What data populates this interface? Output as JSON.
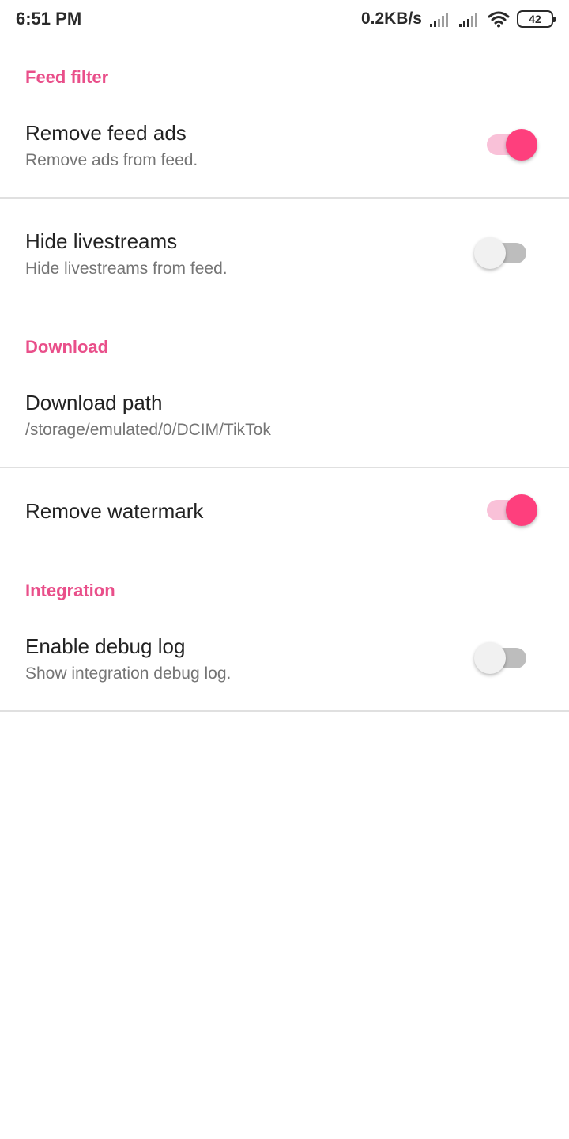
{
  "status_bar": {
    "time": "6:51 PM",
    "net_speed": "0.2KB/s",
    "signal_icon_1": "signal-icon",
    "signal_icon_2": "signal-icon",
    "wifi_icon": "wifi-icon",
    "battery_level": "42"
  },
  "accent_color": "#e94f8a",
  "switch_on_color": "#fe3f7d",
  "sections": {
    "feed_filter": {
      "header": "Feed filter",
      "remove_feed_ads": {
        "title": "Remove feed ads",
        "summary": "Remove ads from feed.",
        "checked": true
      },
      "hide_livestreams": {
        "title": "Hide livestreams",
        "summary": "Hide livestreams from feed.",
        "checked": false
      }
    },
    "download": {
      "header": "Download",
      "download_path": {
        "title": "Download path",
        "summary": "/storage/emulated/0/DCIM/TikTok"
      },
      "remove_watermark": {
        "title": "Remove watermark",
        "checked": true
      }
    },
    "integration": {
      "header": "Integration",
      "enable_debug_log": {
        "title": "Enable debug log",
        "summary": "Show integration debug log.",
        "checked": false
      }
    }
  }
}
